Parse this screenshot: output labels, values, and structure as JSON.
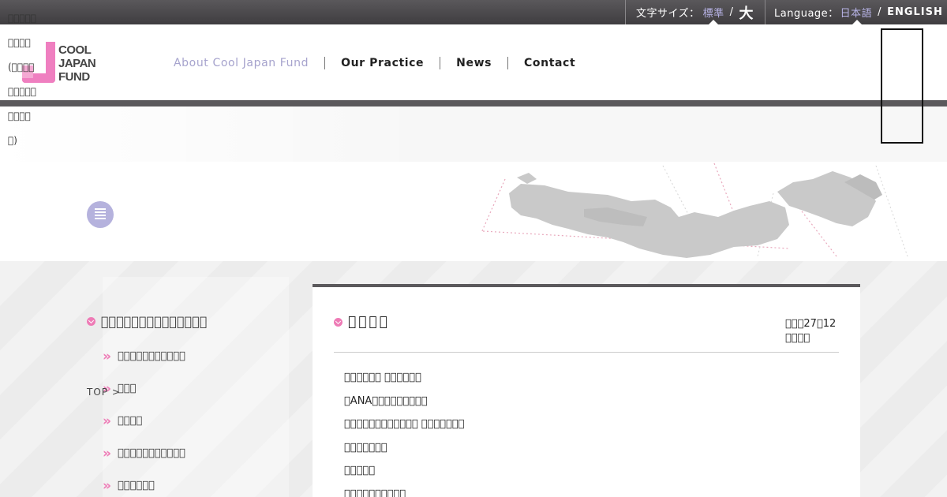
{
  "topbar": {
    "font_size_label": "文字サイズ：",
    "font_size_standard": "標準",
    "font_size_sep": "/",
    "font_size_large": "大",
    "language_label": "Language：",
    "language_ja": "日本語",
    "language_sep": "/",
    "language_en": "ENGLISH"
  },
  "ghost_sidebar": [
    "\u0000\u0000\u0000\u0000\u0000",
    "\u0000\u0000\u0000\u0000",
    "(\u0000\u0000\u0000\u0000",
    "\u0000\u0000\u0000\u0000\u0000",
    "\u0000\u0000\u0000\u0000",
    "\u0000)"
  ],
  "logo": {
    "line1": "COOL",
    "line2": "JAPAN",
    "line3": "FUND"
  },
  "nav": {
    "about": "About Cool Japan Fund",
    "practice": "Our Practice",
    "news": "News",
    "contact": "Contact"
  },
  "sidebar": {
    "title": "\u0000\u0000\u0000\u0000\u0000\u0000\u0000\u0000\u0000\u0000\u0000\u0000\u0000\u0000",
    "items": [
      "\u0000\u0000\u0000\u0000\u0000\u0000\u0000\u0000\u0000\u0000\u0000",
      "\u0000\u0000\u0000",
      "\u0000\u0000\u0000\u0000",
      "\u0000\u0000\u0000\u0000\u0000\u0000\u0000\u0000\u0000\u0000\u0000",
      "\u0000\u0000\u0000\u0000\u0000\u0000"
    ]
  },
  "breadcrumb": "TOP  >",
  "article": {
    "title": "\u0000\u0000\u0000\u0000",
    "date_line1": "\u0000\u0000\u000027\u000012",
    "date_line2": "\u0000\u0000\u0000\u0000",
    "lines": [
      "\u0000\u0000\u0000\u0000\u0000\u0000 \u0000\u0000\u0000\u0000\u0000\u0000",
      "\u0000ANA\u0000\u0000\u0000\u0000\u0000\u0000\u0000\u0000\u0000",
      "\u0000\u0000\u0000\u0000\u0000\u0000\u0000\u0000\u0000\u0000\u0000\u0000 \u0000\u0000\u0000\u0000\u0000\u0000\u0000",
      "\u0000\u0000\u0000\u0000\u0000\u0000\u0000",
      "\u0000\u0000\u0000\u0000\u0000",
      "\u0000\u0000\u0000\u0000\u0000\u0000\u0000\u0000\u0000\u0000"
    ]
  },
  "colors": {
    "accent_pink": "#ee7bb6",
    "accent_lavender": "#a6a3cd",
    "bar_dark": "#5b595c"
  },
  "icons": {
    "hero": "building-icon",
    "bullet": "chevron-down-circle-icon",
    "list": "double-chevron-right-icon"
  }
}
